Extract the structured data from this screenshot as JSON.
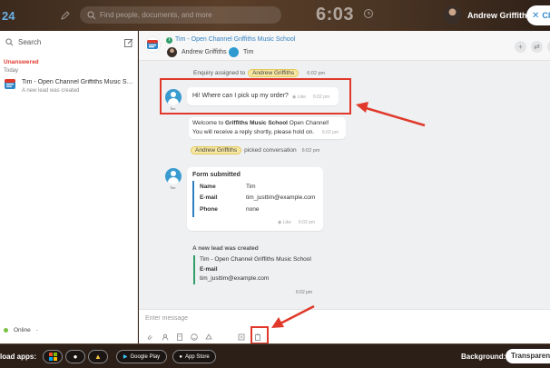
{
  "topbar": {
    "logo": "24",
    "search_placeholder": "Find people, documents, and more",
    "time": "6:03",
    "user_name": "Andrew Griffiths",
    "close_label": "Clo"
  },
  "sidebar": {
    "search_label": "Search",
    "section": "Unanswered",
    "group": "Today",
    "item": {
      "title": "Tim - Open Channel Griffiths Music School",
      "subtitle": "A new lead was created"
    },
    "status": "Online",
    "status_caret": "-"
  },
  "chat": {
    "header": {
      "title": "Tim - Open Channel Griffiths Music School",
      "participant1": "Andrew Griffiths",
      "participant2": "Tim"
    },
    "enquiry": {
      "text": "Enquiry assigned to",
      "tag": "Andrew Griffiths",
      "time": "6:02 pm"
    },
    "msg1": {
      "avatar_label": "Tim",
      "text": "Hi! Where can I pick up my order?",
      "like": "Like",
      "time": "6:02 pm"
    },
    "welcome": {
      "pre": "Welcome to ",
      "bold": "Griffiths Music School",
      "post": " Open Channel!",
      "line2": "You will receive a reply shortly, please hold on.",
      "time": "6:02 pm"
    },
    "picked": {
      "tag": "Andrew Griffiths",
      "text": "picked conversation",
      "time": "6:02 pm"
    },
    "form": {
      "avatar_label": "Tim",
      "title": "Form submitted",
      "rows": [
        {
          "label": "Name",
          "value": "Tim"
        },
        {
          "label": "E-mail",
          "value": "tim_justtim@example.com"
        },
        {
          "label": "Phone",
          "value": "none"
        }
      ],
      "like": "Like",
      "time": "6:02 pm"
    },
    "lead": {
      "title": "A new lead was created",
      "line1": "Tim - Open Channel Griffiths Music School",
      "line2": "E-mail",
      "line3": "tim_justtim@example.com",
      "time": "6:02 pm"
    },
    "input_placeholder": "Enter message"
  },
  "bottombar": {
    "download_label": "load apps:",
    "google_play": "Google Play",
    "app_store": "App Store",
    "background_label": "Background:",
    "background_value": "Transparent"
  },
  "colors": {
    "accent": "#2f7fc1",
    "highlight": "#e0392b",
    "tag_bg": "#f7e7a1",
    "online": "#7cc043"
  }
}
